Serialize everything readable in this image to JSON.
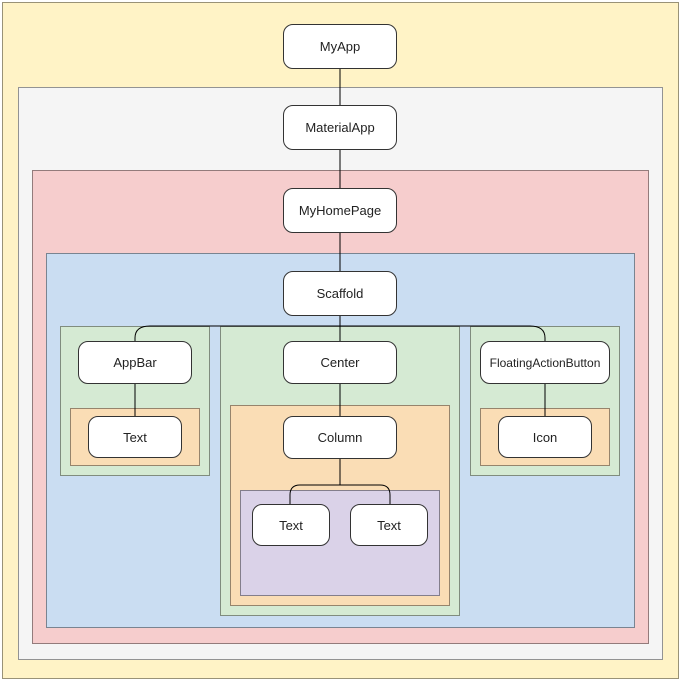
{
  "nodes": {
    "myapp": "MyApp",
    "materialapp": "MaterialApp",
    "myhomepage": "MyHomePage",
    "scaffold": "Scaffold",
    "appbar": "AppBar",
    "center": "Center",
    "fab": "FloatingActionButton",
    "text_appbar": "Text",
    "column": "Column",
    "icon": "Icon",
    "text_left": "Text",
    "text_right": "Text"
  },
  "regions": {
    "yellow_outer": "#FFF3C6",
    "gray": "#F5F5F5",
    "pink": "#F6CDCD",
    "blue": "#CADDF2",
    "green": "#D5EAD3",
    "orange_left": "#FADDB5",
    "orange_mid": "#FADDB5",
    "orange_right": "#FADDB5",
    "purple": "#DAD2E8"
  }
}
